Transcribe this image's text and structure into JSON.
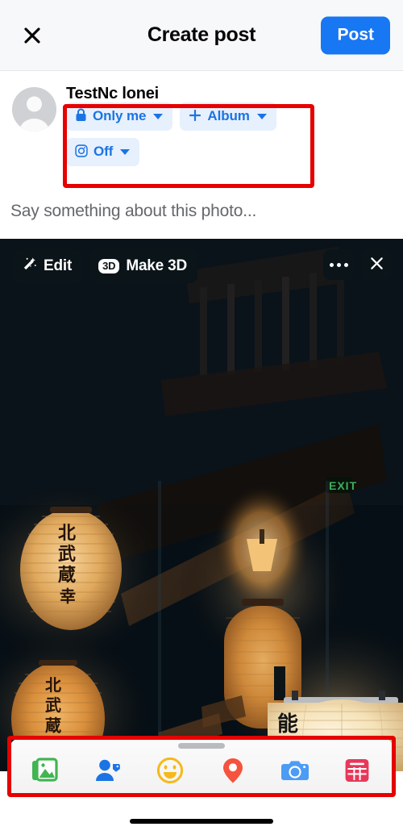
{
  "header": {
    "close_icon": "close-x-icon",
    "title": "Create post",
    "post_label": "Post"
  },
  "composer": {
    "avatar_icon": "default-user-avatar",
    "username": "TestNc lonei",
    "pills": [
      {
        "icon": "lock-icon",
        "label": "Only me",
        "caret": "chevron-down-icon"
      },
      {
        "icon": "plus-icon",
        "label": "Album",
        "caret": "chevron-down-icon"
      },
      {
        "icon": "instagram-icon",
        "label": "Off",
        "caret": "chevron-down-icon"
      }
    ],
    "caption_placeholder": "Say something about this photo..."
  },
  "photo": {
    "alt": "Dark Japanese interior with glowing paper lanterns and a staircase",
    "exit_sign": "EXIT",
    "overlay_buttons": [
      {
        "icon": "magic-wand-icon",
        "label": "Edit"
      },
      {
        "icon": "3d-badge-icon",
        "label": "Make 3D"
      }
    ],
    "overlay_right": [
      {
        "icon": "more-dots-icon"
      },
      {
        "icon": "close-x-icon"
      }
    ]
  },
  "toolbar": {
    "grabber": "drag-handle",
    "items": [
      {
        "icon": "photo-library-icon",
        "name": "photo-video",
        "color": "#41b552"
      },
      {
        "icon": "tag-person-icon",
        "name": "tag-people",
        "color": "#1b74e4"
      },
      {
        "icon": "emoji-smile-icon",
        "name": "feeling",
        "color": "#f5b919"
      },
      {
        "icon": "location-pin-icon",
        "name": "check-in",
        "color": "#f5533d"
      },
      {
        "icon": "camera-icon",
        "name": "camera",
        "color": "#4c9cf5"
      },
      {
        "icon": "gif-grid-icon",
        "name": "gif",
        "color": "#e8385a"
      }
    ]
  },
  "system": {
    "home_indicator": "home-indicator"
  },
  "colors": {
    "accent_blue": "#1877f2",
    "pill_bg": "#e7f0fd",
    "pill_text": "#1b74e4",
    "annotation_red": "#e60000",
    "header_bg": "#f7f8fa",
    "caption_gray": "#65676b"
  }
}
